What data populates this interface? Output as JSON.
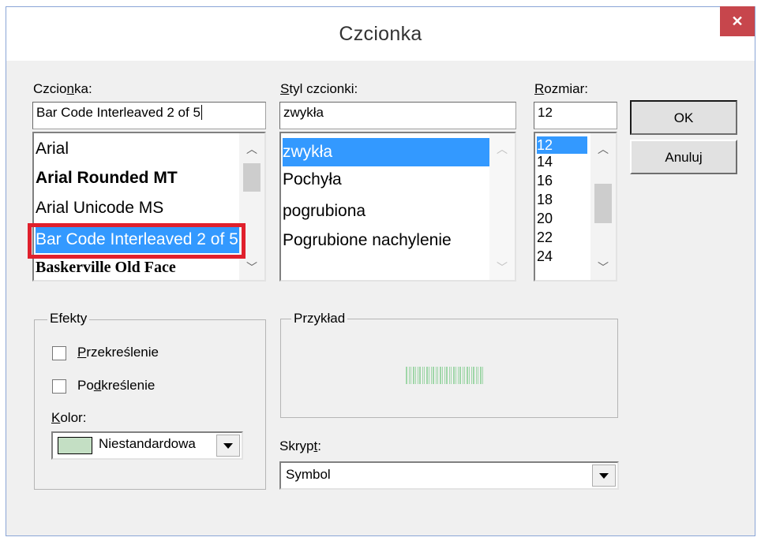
{
  "dialog": {
    "title": "Czcionka",
    "close_label": "✕"
  },
  "font": {
    "label_pre": "Czcio",
    "label_mnemonic": "n",
    "label_post": "ka:",
    "value": "Bar Code Interleaved 2 of 5",
    "items": [
      "Arial",
      "Arial Rounded MT",
      "Arial Unicode MS",
      "Bar Code Interleaved 2 of 5",
      "Baskerville Old Face"
    ],
    "selected_index": 3
  },
  "style": {
    "label_pre": "",
    "label_mnemonic": "S",
    "label_post": "tyl czcionki:",
    "value": "zwykła",
    "items": [
      "zwykła",
      "Pochyła",
      "pogrubiona",
      "Pogrubione nachylenie"
    ],
    "selected_index": 0
  },
  "size": {
    "label_pre": "",
    "label_mnemonic": "R",
    "label_post": "ozmiar:",
    "value": "12",
    "items": [
      "12",
      "14",
      "16",
      "18",
      "20",
      "22",
      "24"
    ],
    "selected_index": 0
  },
  "buttons": {
    "ok": "OK",
    "cancel": "Anuluj"
  },
  "effects": {
    "title": "Efekty",
    "strike_pre": "",
    "strike_mnemonic": "P",
    "strike_post": "rzekreślenie",
    "underline_pre": "Po",
    "underline_mnemonic": "d",
    "underline_post": "kreślenie",
    "color_pre": "",
    "color_mnemonic": "K",
    "color_post": "olor:",
    "color_value": "Niestandardowa",
    "color_swatch": "#c4dfc4"
  },
  "sample": {
    "title": "Przykład"
  },
  "script": {
    "label_pre": "Skryp",
    "label_mnemonic": "t",
    "label_post": ":",
    "value": "Symbol"
  },
  "colors": {
    "selection": "#3399ff",
    "highlight": "#e0202c",
    "close": "#c7464c"
  }
}
